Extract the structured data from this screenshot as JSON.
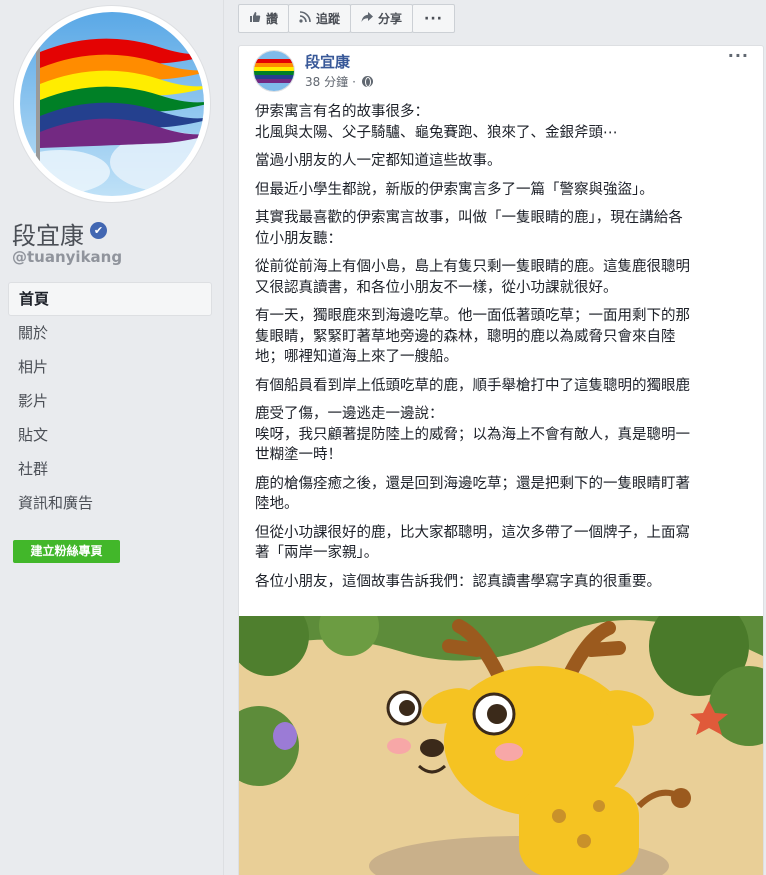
{
  "profile": {
    "name": "段宜康",
    "verified_icon": "✔",
    "handle": "@tuanyikang"
  },
  "nav": {
    "items": [
      {
        "label": "首頁",
        "active": true
      },
      {
        "label": "關於"
      },
      {
        "label": "相片"
      },
      {
        "label": "影片"
      },
      {
        "label": "貼文"
      },
      {
        "label": "社群"
      },
      {
        "label": "資訊和廣告"
      }
    ],
    "create_button": "建立粉絲專頁"
  },
  "action_bar": {
    "like": {
      "icon": "thumbs-up-icon",
      "label": "讚"
    },
    "follow": {
      "icon": "rss-icon",
      "label": "追蹤"
    },
    "share": {
      "icon": "share-arrow-icon",
      "label": "分享"
    },
    "more": "···"
  },
  "post": {
    "author": "段宜康",
    "time": "38 分鐘",
    "more": "···",
    "paragraphs": [
      [
        "伊索寓言有名的故事很多：",
        "北風與太陽、父子騎驢、龜兔賽跑、狼來了、金銀斧頭⋯"
      ],
      [
        "當過小朋友的人一定都知道這些故事。"
      ],
      [
        "但最近小學生都說，新版的伊索寓言多了一篇「警察與強盜」。"
      ],
      [
        "其實我最喜歡的伊索寓言故事，叫做「一隻眼睛的鹿」，現在講給各",
        "位小朋友聽："
      ],
      [
        "從前從前海上有個小島，島上有隻只剩一隻眼睛的鹿。這隻鹿很聰明",
        "又很認真讀書，和各位小朋友不一樣，從小功課就很好。"
      ],
      [
        "有一天，獨眼鹿來到海邊吃草。他一面低著頭吃草；一面用剩下的那",
        "隻眼睛，緊緊盯著草地旁邊的森林，聰明的鹿以為威脅只會來自陸",
        "地；哪裡知道海上來了一艘船。"
      ],
      [
        "有個船員看到岸上低頭吃草的鹿，順手舉槍打中了這隻聰明的獨眼鹿"
      ],
      [
        "鹿受了傷，一邊逃走一邊說：",
        "唉呀，我只顧著提防陸上的威脅；以為海上不會有敵人，真是聰明一",
        "世糊塗一時！"
      ],
      [
        "鹿的槍傷痊癒之後，還是回到海邊吃草；還是把剩下的一隻眼睛盯著",
        "陸地。"
      ],
      [
        "但從小功課很好的鹿，比大家都聰明，這次多帶了一個牌子，上面寫",
        "著「兩岸一家親」。"
      ],
      [
        "各位小朋友，這個故事告訴我們：認真讀書學寫字真的很重要。"
      ]
    ]
  },
  "colors": {
    "background": "#e9ebee",
    "link": "#385898",
    "green_button": "#42b72a",
    "verified": "#4267b2"
  }
}
